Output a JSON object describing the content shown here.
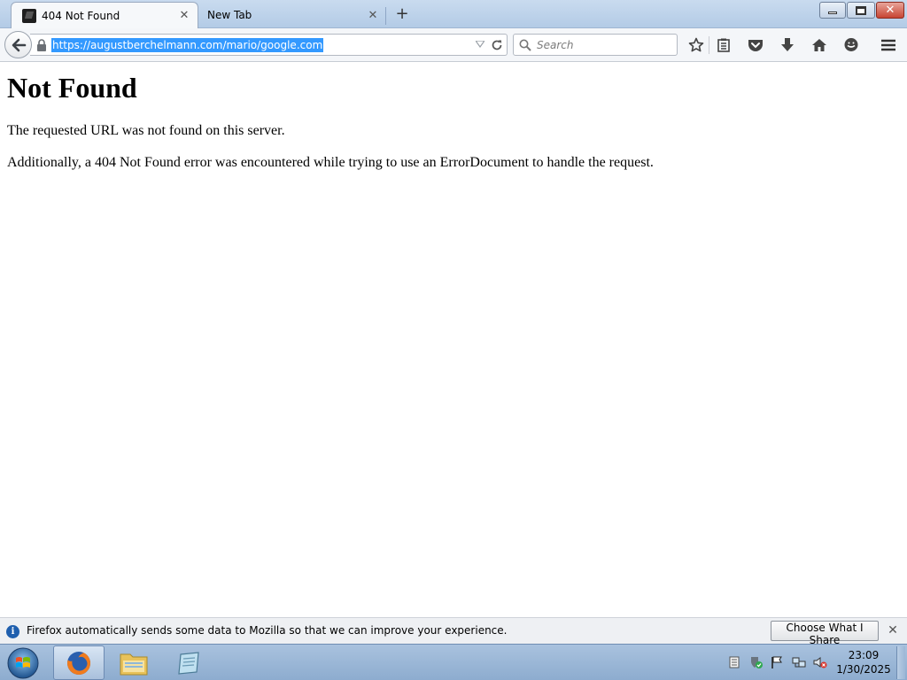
{
  "window": {
    "tabs": [
      {
        "title": "404 Not Found",
        "active": true
      },
      {
        "title": "New Tab",
        "active": false
      }
    ],
    "new_tab_label": "+",
    "close_label": "✕"
  },
  "toolbar": {
    "url": "https://augustberchelmann.com/mario/google.com",
    "search_placeholder": "Search"
  },
  "page": {
    "heading": "Not Found",
    "paragraphs": [
      "The requested URL was not found on this server.",
      "Additionally, a 404 Not Found error was encountered while trying to use an ErrorDocument to handle the request."
    ]
  },
  "notification": {
    "text": "Firefox automatically sends some data to Mozilla so that we can improve your experience.",
    "button_label": "Choose What I Share",
    "close_label": "✕"
  },
  "taskbar": {
    "time": "23:09",
    "date": "1/30/2025"
  },
  "colors": {
    "selection": "#3399ff",
    "titlebar": "#c9dbef",
    "taskbar": "#a9c2de",
    "close_button": "#c74433"
  }
}
